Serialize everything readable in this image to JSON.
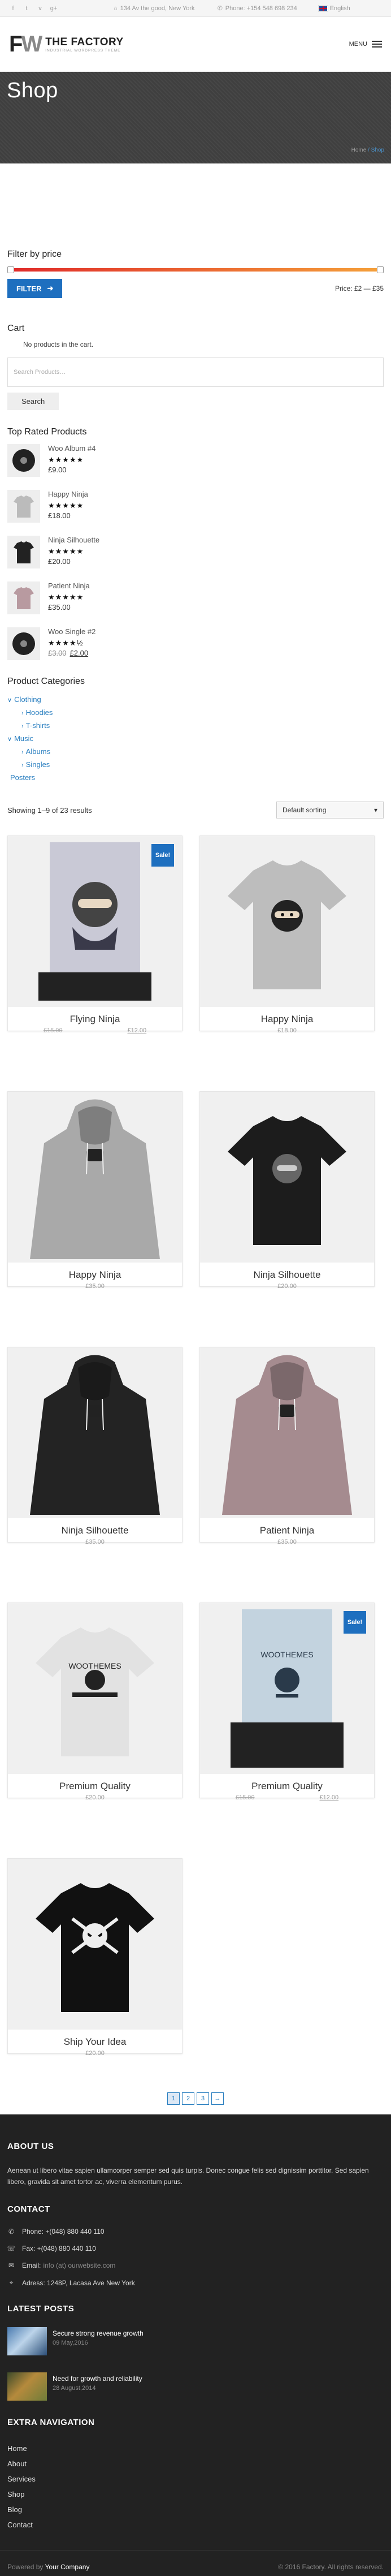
{
  "topbar": {
    "social": [
      "facebook-icon",
      "twitter-icon",
      "vimeo-icon",
      "google-plus-icon"
    ],
    "address": "134 Av the good, New York",
    "phone": "Phone: +154 548 698 234",
    "language": "English"
  },
  "header": {
    "logo_mark": "FW",
    "logo_title": "THE FACTORY",
    "logo_tagline": "INDUSTRIAL WORDPRESS THEME",
    "menu_label": "MENU"
  },
  "hero": {
    "title": "Shop",
    "breadcrumb_home": "Home",
    "breadcrumb_current": "Shop"
  },
  "filter": {
    "title": "Filter by price",
    "button": "FILTER",
    "price_label": "Price: £2 — £35",
    "range": [
      2,
      35
    ]
  },
  "cart": {
    "title": "Cart",
    "empty": "No products in the cart."
  },
  "search": {
    "placeholder": "Search Products…",
    "button": "Search"
  },
  "top_rated": {
    "title": "Top Rated Products",
    "items": [
      {
        "name": "Woo Album #4",
        "rating": 5,
        "price": "£9.00",
        "old": ""
      },
      {
        "name": "Happy Ninja",
        "rating": 5,
        "price": "£18.00",
        "old": ""
      },
      {
        "name": "Ninja Silhouette",
        "rating": 5,
        "price": "£20.00",
        "old": ""
      },
      {
        "name": "Patient Ninja",
        "rating": 5,
        "price": "£35.00",
        "old": ""
      },
      {
        "name": "Woo Single #2",
        "rating": 4.5,
        "price": "£2.00",
        "old": "£3.00"
      }
    ]
  },
  "categories": {
    "title": "Product Categories",
    "clothing": "Clothing",
    "hoodies": "Hoodies",
    "tshirts": "T-shirts",
    "music": "Music",
    "albums": "Albums",
    "singles": "Singles",
    "posters": "Posters"
  },
  "results": {
    "text": "Showing 1–9 of 23 results",
    "sorting": "Default sorting"
  },
  "products": [
    {
      "title": "Flying Ninja",
      "price": "£12.00",
      "old": "£15.00",
      "sale": "Sale!",
      "kind": "poster"
    },
    {
      "title": "Happy Ninja",
      "price": "£18.00",
      "old": "",
      "sale": "",
      "kind": "tshirt-grey"
    },
    {
      "title": "Happy Ninja",
      "price": "£35.00",
      "old": "",
      "sale": "",
      "kind": "hoodie-grey"
    },
    {
      "title": "Ninja Silhouette",
      "price": "£20.00",
      "old": "",
      "sale": "",
      "kind": "tshirt-black"
    },
    {
      "title": "Ninja Silhouette",
      "price": "£35.00",
      "old": "",
      "sale": "",
      "kind": "hoodie-black"
    },
    {
      "title": "Patient Ninja",
      "price": "£35.00",
      "old": "",
      "sale": "",
      "kind": "hoodie-mauve"
    },
    {
      "title": "Premium Quality",
      "price": "£20.00",
      "old": "",
      "sale": "",
      "kind": "tshirt-white"
    },
    {
      "title": "Premium Quality",
      "price": "£12.00",
      "old": "£15.00",
      "sale": "Sale!",
      "kind": "poster-blue"
    },
    {
      "title": "Ship Your Idea",
      "price": "£20.00",
      "old": "",
      "sale": "",
      "kind": "tshirt-skull"
    }
  ],
  "pagination": {
    "pages": [
      "1",
      "2",
      "3"
    ],
    "next": "→",
    "current": "1"
  },
  "footer": {
    "about_title": "ABOUT US",
    "about_text": "Aenean ut libero vitae sapien ullamcorper semper sed quis turpis. Donec congue felis sed dignissim porttitor. Sed sapien libero, gravida sit amet tortor ac, viverra elementum purus.",
    "contact_title": "CONTACT",
    "phone": "Phone: +(048) 880 440 110",
    "fax": "Fax: +(048) 880 440 110",
    "email_label": "Email:",
    "email": "info (at) ourwebsite.com",
    "address": "Adress: 1248P, Lacasa Ave New York",
    "posts_title": "LATEST POSTS",
    "posts": [
      {
        "title": "Secure strong revenue growth",
        "date": "09 May,2016"
      },
      {
        "title": "Need for growth and reliability",
        "date": "28 August,2014"
      }
    ],
    "nav_title": "EXTRA NAVIGATION",
    "nav": [
      "Home",
      "About",
      "Services",
      "Shop",
      "Blog",
      "Contact"
    ],
    "powered_prefix": "Powered by",
    "powered_by": "Your Company",
    "copyright": "© 2016 Factory. All rights reserved."
  },
  "colors": {
    "accent": "#1e6fbf",
    "link": "#2a7fc0",
    "footer_bg": "#222222"
  }
}
